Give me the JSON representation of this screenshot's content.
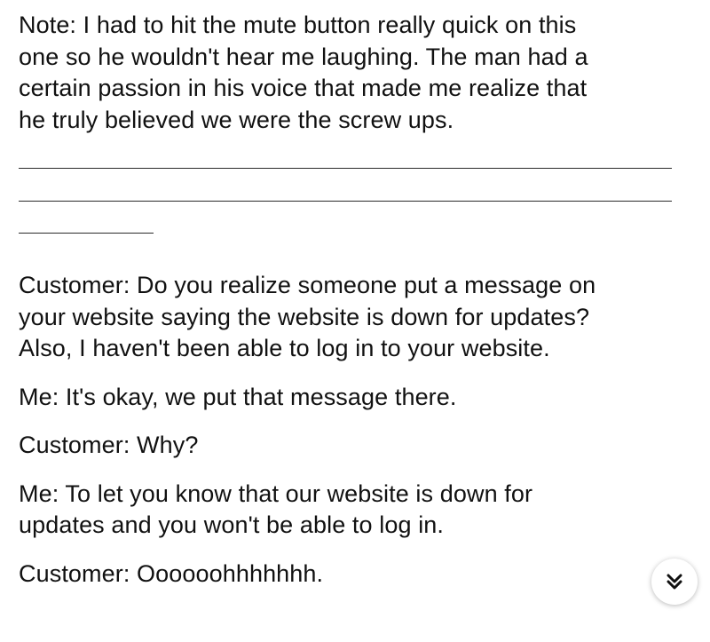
{
  "note": "Note: I had to hit the mute button really quick on this\none so he wouldn't hear me laughing. The man had a\ncertain passion in his voice that made me realize that\nhe truly believed we were the screw ups.",
  "dialogue": [
    "Customer: Do you realize someone put a message on\nyour website saying the website is down for updates?\nAlso, I haven't been able to log in to your website.",
    "Me: It's okay, we put that message there.",
    "Customer: Why?",
    "Me: To let you know that our website is down for\nupdates and you won't be able to log in.",
    "Customer: Oooooohhhhhhh."
  ],
  "scroll_button": {
    "icon": "double-chevron-down-icon"
  }
}
